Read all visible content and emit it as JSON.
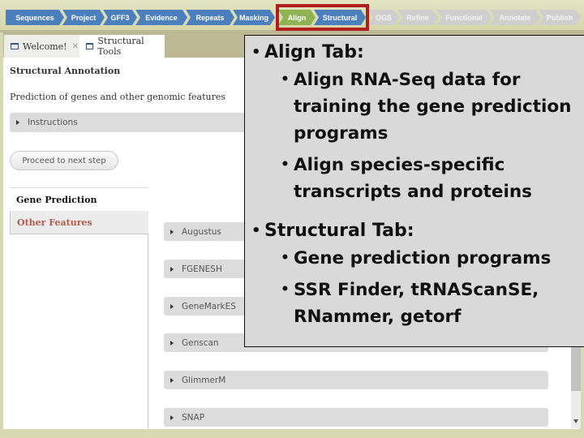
{
  "workflow": {
    "steps": [
      {
        "label": "Sequences",
        "state": "done"
      },
      {
        "label": "Project",
        "state": "done"
      },
      {
        "label": "GFF3",
        "state": "done"
      },
      {
        "label": "Evidence",
        "state": "done"
      },
      {
        "label": "Repeats",
        "state": "done"
      },
      {
        "label": "Masking",
        "state": "done"
      },
      {
        "label": "Align",
        "state": "current"
      },
      {
        "label": "Structural",
        "state": "active"
      },
      {
        "label": "OGS",
        "state": "todo"
      },
      {
        "label": "Refine",
        "state": "todo"
      },
      {
        "label": "Functional",
        "state": "todo"
      },
      {
        "label": "Annotate",
        "state": "todo"
      },
      {
        "label": "Publish",
        "state": "todo"
      }
    ],
    "highlight_color": "#b01e1e"
  },
  "tabs": [
    {
      "label": "Welcome!",
      "closable": true
    },
    {
      "label": "Structural Tools",
      "closable": false
    }
  ],
  "main": {
    "title": "Structural Annotation",
    "subtitle": "Prediction of genes and other genomic features",
    "instructions_label": "Instructions",
    "proceed_button": "Proceed to next step",
    "subnav": {
      "items": [
        {
          "label": "Gene Prediction"
        },
        {
          "label": "Other Features"
        }
      ]
    },
    "tools": [
      {
        "label": "Augustus"
      },
      {
        "label": "FGENESH"
      },
      {
        "label": "GeneMarkES"
      },
      {
        "label": "Genscan"
      },
      {
        "label": "GlimmerM"
      },
      {
        "label": "SNAP"
      }
    ]
  },
  "callout": {
    "sections": [
      {
        "heading": "Align Tab:",
        "bullets": [
          "Align RNA-Seq data for training the gene prediction programs",
          "Align species-specific transcripts and proteins"
        ]
      },
      {
        "heading": "Structural Tab:",
        "bullets": [
          "Gene prediction programs",
          "SSR Finder, tRNAScanSE, RNammer, getorf"
        ]
      }
    ]
  },
  "colors": {
    "step_done": "#4b7fbe",
    "step_current": "#8fb252",
    "step_todo": "#cfcfcf",
    "other_features_text": "#b55a4a"
  }
}
